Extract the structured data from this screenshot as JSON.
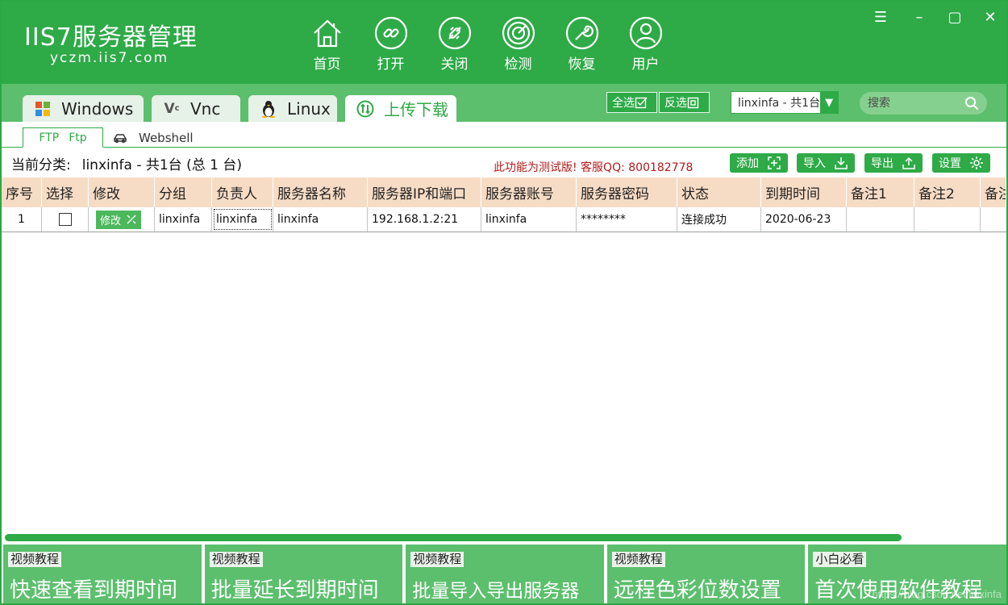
{
  "app": {
    "logo_title": "IIS7服务器管理",
    "logo_url": "yczm.iis7.com"
  },
  "nav": [
    {
      "label": "首页",
      "icon": "home-icon"
    },
    {
      "label": "打开",
      "icon": "link-icon"
    },
    {
      "label": "关闭",
      "icon": "unlink-icon"
    },
    {
      "label": "检测",
      "icon": "radar-icon"
    },
    {
      "label": "恢复",
      "icon": "wrench-icon"
    },
    {
      "label": "用户",
      "icon": "user-icon"
    }
  ],
  "window_controls": {
    "menu": "☰",
    "minimize": "–",
    "maximize": "▢",
    "close": "✕"
  },
  "tabs": [
    {
      "label": "Windows",
      "icon": "windows-icon"
    },
    {
      "label": "Vnc",
      "icon": "vnc-icon"
    },
    {
      "label": "Linux",
      "icon": "linux-icon"
    },
    {
      "label": "上传下载",
      "icon": "transfer-icon"
    }
  ],
  "toolbar": {
    "select_all": "全选",
    "invert_select": "反选",
    "group_combo": "linxinfa - 共1台",
    "search_placeholder": "搜索"
  },
  "subtabs": {
    "ftp_tag": "FTP",
    "ftp_label": "Ftp",
    "webshell_label": "Webshell"
  },
  "category": {
    "label": "当前分类:",
    "value": "linxinfa - 共1台 (总 1 台)"
  },
  "notice": "此功能为测试版!  客服QQ:  800182778",
  "actions": {
    "add": "添加",
    "import": "导入",
    "export": "导出",
    "settings": "设置"
  },
  "table": {
    "headers": [
      "序号",
      "选择",
      "修改",
      "分组",
      "负责人",
      "服务器名称",
      "服务器IP和端口",
      "服务器账号",
      "服务器密码",
      "状态",
      "到期时间",
      "备注1",
      "备注2",
      "备注"
    ],
    "rows": [
      {
        "index": "1",
        "checked": false,
        "edit_label": "修改",
        "group": "linxinfa",
        "owner": "linxinfa",
        "name": "linxinfa",
        "ip_port": "192.168.1.2:21",
        "account": "linxinfa",
        "password": "********",
        "status": "连接成功",
        "expire": "2020-06-23",
        "note1": "",
        "note2": "",
        "note3": ""
      }
    ]
  },
  "tiles": [
    {
      "tag": "视频教程",
      "title": "快速查看到期时间"
    },
    {
      "tag": "视频教程",
      "title": "批量延长到期时间"
    },
    {
      "tag": "视频教程",
      "title": "批量导入导出服务器"
    },
    {
      "tag": "视频教程",
      "title": "远程色彩位数设置"
    },
    {
      "tag": "小白必看",
      "title": "首次使用软件教程"
    }
  ],
  "watermark": "https://blog.csdn.net/linxinfa",
  "colors": {
    "brand": "#2eaa47",
    "brand_light": "#5cbf6d",
    "header_row": "#f7dcc5",
    "notice": "#b31b1b"
  }
}
